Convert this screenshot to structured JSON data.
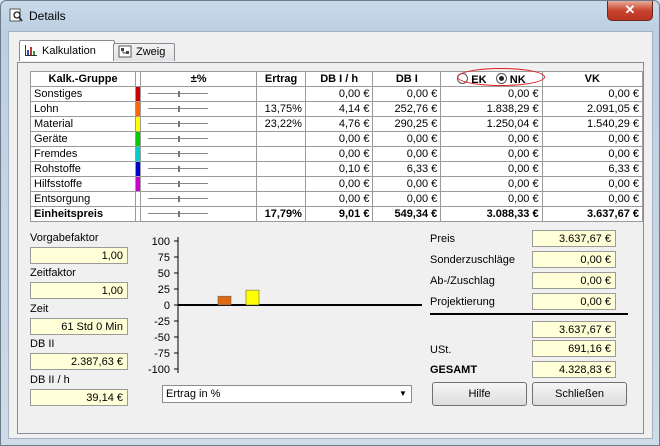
{
  "window": {
    "title": "Details",
    "close_label": "✕"
  },
  "tabs": [
    {
      "label": "Kalkulation",
      "icon": "bar-chart-icon",
      "active": true
    },
    {
      "label": "Zweig",
      "icon": "tree-icon",
      "active": false
    }
  ],
  "table": {
    "headers": {
      "gruppe": "Kalk.-Gruppe",
      "pm": "±%",
      "ertrag": "Ertrag",
      "db1h": "DB I / h",
      "db1": "DB I",
      "ek": "EK",
      "nk": "NK",
      "vk": "VK"
    },
    "rows": [
      {
        "name": "Sonstiges",
        "color": "#cc0000",
        "ertrag": "",
        "db1h": "0,00 €",
        "db1": "0,00 €",
        "nk": "0,00 €",
        "vk": "0,00 €"
      },
      {
        "name": "Lohn",
        "color": "#ff6600",
        "ertrag": "13,75%",
        "db1h": "4,14 €",
        "db1": "252,76 €",
        "nk": "1.838,29 €",
        "vk": "2.091,05 €"
      },
      {
        "name": "Material",
        "color": "#ffff00",
        "ertrag": "23,22%",
        "db1h": "4,76 €",
        "db1": "290,25 €",
        "nk": "1.250,04 €",
        "vk": "1.540,29 €"
      },
      {
        "name": "Geräte",
        "color": "#00cc00",
        "ertrag": "",
        "db1h": "0,00 €",
        "db1": "0,00 €",
        "nk": "0,00 €",
        "vk": "0,00 €"
      },
      {
        "name": "Fremdes",
        "color": "#00cccc",
        "ertrag": "",
        "db1h": "0,00 €",
        "db1": "0,00 €",
        "nk": "0,00 €",
        "vk": "0,00 €"
      },
      {
        "name": "Rohstoffe",
        "color": "#0000cc",
        "ertrag": "",
        "db1h": "0,10 €",
        "db1": "6,33 €",
        "nk": "0,00 €",
        "vk": "6,33 €"
      },
      {
        "name": "Hilfsstoffe",
        "color": "#cc00cc",
        "ertrag": "",
        "db1h": "0,00 €",
        "db1": "0,00 €",
        "nk": "0,00 €",
        "vk": "0,00 €"
      },
      {
        "name": "Entsorgung",
        "color": "#ffffff",
        "ertrag": "",
        "db1h": "0,00 €",
        "db1": "0,00 €",
        "nk": "0,00 €",
        "vk": "0,00 €"
      },
      {
        "name": "Einheitspreis",
        "color": "#ffffff",
        "bold": true,
        "ertrag": "17,79%",
        "db1h": "9,01 €",
        "db1": "549,34 €",
        "nk": "3.088,33 €",
        "vk": "3.637,67 €"
      }
    ]
  },
  "left_fields": {
    "vorgabefaktor": {
      "label": "Vorgabefaktor",
      "value": "1,00"
    },
    "zeitfaktor": {
      "label": "Zeitfaktor",
      "value": "1,00"
    },
    "zeit": {
      "label": "Zeit",
      "value": "61 Std 0 Min"
    },
    "db2": {
      "label": "DB II",
      "value": "2.387,63 €"
    },
    "db2h": {
      "label": "DB II / h",
      "value": "39,14 €"
    }
  },
  "chart_data": {
    "type": "bar",
    "categories": [
      "Lohn",
      "Material"
    ],
    "values": [
      13.75,
      23.22
    ],
    "colors": [
      "#e06a10",
      "#ffff00"
    ],
    "ylim": [
      -100,
      100
    ],
    "yticks": [
      "100",
      "75",
      "50",
      "25",
      "0",
      "-25",
      "-50",
      "-75",
      "-100"
    ]
  },
  "chart_select": {
    "value": "Ertrag in %"
  },
  "right_fields": {
    "preis": {
      "label": "Preis",
      "value": "3.637,67 €"
    },
    "sonder": {
      "label": "Sonderzuschläge",
      "value": "0,00 €"
    },
    "abzu": {
      "label": "Ab-/Zuschlag",
      "value": "0,00 €"
    },
    "projekt": {
      "label": "Projektierung",
      "value": "0,00 €"
    },
    "netto": {
      "value": "3.637,67 €"
    },
    "ust": {
      "label": "USt.",
      "value": "691,16 €"
    },
    "gesamt": {
      "label": "GESAMT",
      "value": "4.328,83 €"
    }
  },
  "buttons": {
    "hilfe": "Hilfe",
    "schliessen": "Schließen"
  }
}
